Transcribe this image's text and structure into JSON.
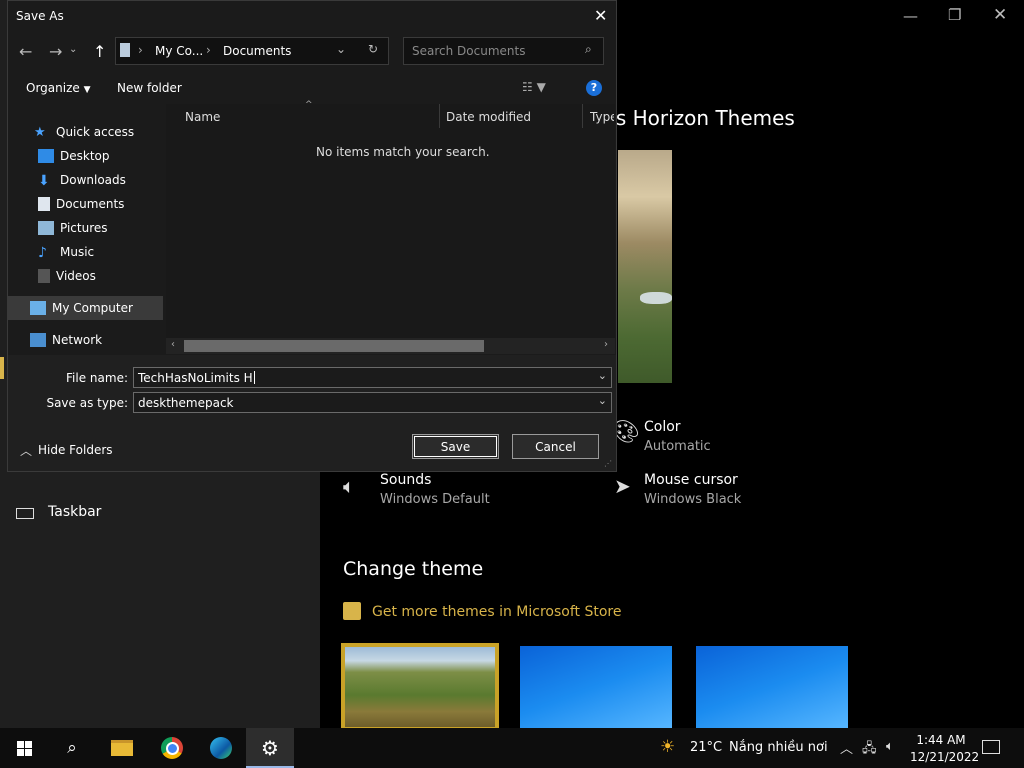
{
  "settings": {
    "heading_partial": "ts Horizon Themes",
    "color_label": "Color",
    "color_value": "Automatic",
    "sounds_label": "Sounds",
    "sounds_value": "Windows Default",
    "cursor_label": "Mouse cursor",
    "cursor_value": "Windows Black",
    "change_theme": "Change theme",
    "store_link": "Get more themes in Microsoft Store",
    "taskbar_item": "Taskbar",
    "accent": "#d8b44a"
  },
  "dialog": {
    "title": "Save As",
    "breadcrumb": [
      "My Co...",
      "Documents"
    ],
    "search_placeholder": "Search Documents",
    "organize": "Organize",
    "new_folder": "New folder",
    "nav": [
      {
        "label": "Quick access",
        "icon": "star-icon"
      },
      {
        "label": "Desktop",
        "icon": "desktop-icon",
        "pinned": true
      },
      {
        "label": "Downloads",
        "icon": "download-icon",
        "pinned": true
      },
      {
        "label": "Documents",
        "icon": "document-icon",
        "pinned": true
      },
      {
        "label": "Pictures",
        "icon": "pictures-icon",
        "pinned": true
      },
      {
        "label": "Music",
        "icon": "music-icon"
      },
      {
        "label": "Videos",
        "icon": "video-icon"
      },
      {
        "label": "My Computer",
        "icon": "computer-icon"
      },
      {
        "label": "Network",
        "icon": "network-icon"
      }
    ],
    "columns": [
      "Name",
      "Date modified",
      "Type"
    ],
    "empty_message": "No items match your search.",
    "file_name_label": "File name:",
    "file_name_value": "TechHasNoLimits H",
    "save_type_label": "Save as type:",
    "save_type_value": "deskthemepack",
    "hide_folders": "Hide Folders",
    "save_button": "Save",
    "cancel_button": "Cancel"
  },
  "taskbar": {
    "temperature": "21°C",
    "weather": "Nắng nhiều nơi",
    "time": "1:44 AM",
    "date": "12/21/2022"
  }
}
